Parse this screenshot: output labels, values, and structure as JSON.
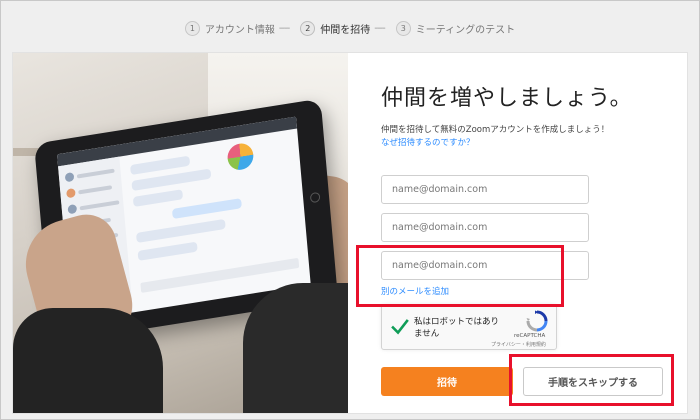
{
  "stepper": {
    "steps": [
      {
        "num": "1",
        "label": "アカウント情報",
        "sep": "----"
      },
      {
        "num": "2",
        "label": "仲間を招待",
        "sep": "----"
      },
      {
        "num": "3",
        "label": "ミーティングのテスト",
        "sep": ""
      }
    ],
    "active_index": 2
  },
  "invite_form": {
    "title": "仲間を増やしましょう。",
    "subtitle": "仲間を招待して無料のZoomアカウントを作成しましょう！",
    "why_link": "なぜ招待するのですか？",
    "email_placeholder": "name@domain.com",
    "email_values": [
      "",
      "",
      ""
    ],
    "add_email_link": "別のメールを追加",
    "invite_button": "招待",
    "skip_button": "手順をスキップする"
  },
  "recaptcha": {
    "label": "私はロボットではありません",
    "brand": "reCAPTCHA",
    "terms": "プライバシー・利用規約",
    "checked": true
  },
  "colors": {
    "accent_orange": "#f5811f",
    "link_blue": "#2d8cff",
    "highlight_red": "#e8102b",
    "check_green": "#0f9d58"
  }
}
